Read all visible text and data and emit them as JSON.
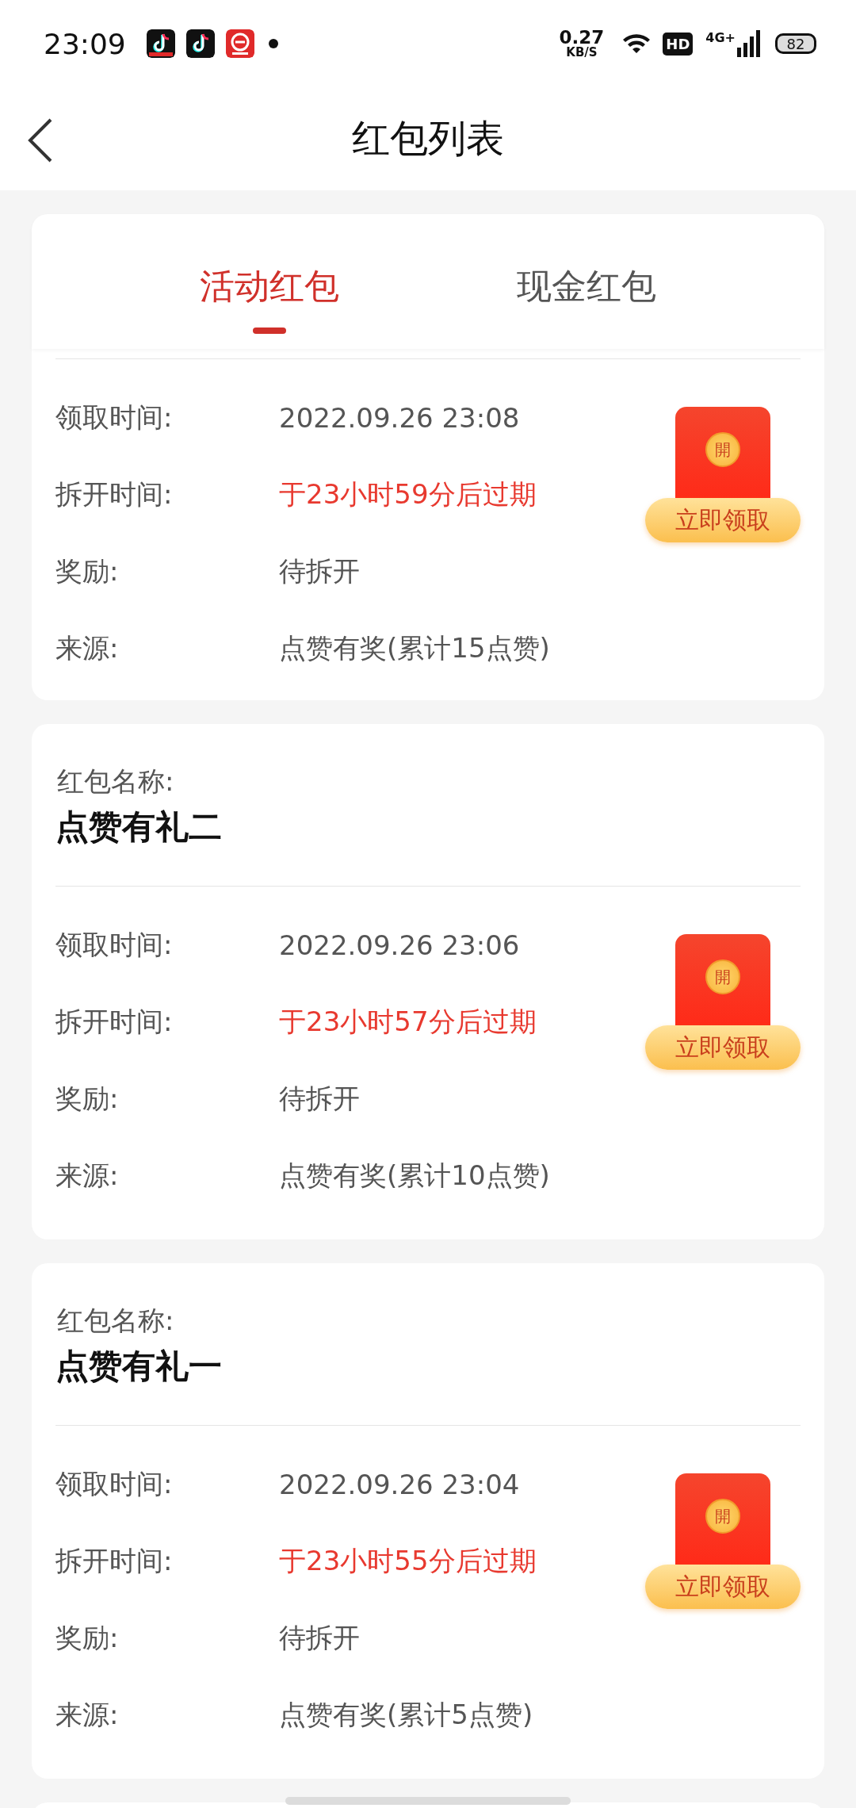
{
  "status_bar": {
    "time": "23:09",
    "speed": "0.27",
    "speed_unit": "KB/S",
    "hd": "HD",
    "network": "4G+",
    "battery": "82"
  },
  "header": {
    "title": "红包列表"
  },
  "tabs": [
    {
      "label": "活动红包",
      "selected": true
    },
    {
      "label": "现金红包",
      "selected": false
    }
  ],
  "cards": [
    {
      "fields": [
        {
          "label": "领取时间:",
          "value": "2022.09.26 23:08",
          "kind": "plain"
        },
        {
          "label": "拆开时间:",
          "value": "于23小时59分后过期",
          "kind": "expiry"
        },
        {
          "label": "奖励:",
          "value": "待拆开",
          "kind": "plain"
        },
        {
          "label": "来源:",
          "value": "点赞有奖(累计15点赞)",
          "kind": "plain"
        }
      ],
      "seal": "開",
      "button": "立即领取"
    },
    {
      "name_label": "红包名称:",
      "name": "点赞有礼二",
      "fields": [
        {
          "label": "领取时间:",
          "value": "2022.09.26 23:06",
          "kind": "plain"
        },
        {
          "label": "拆开时间:",
          "value": "于23小时57分后过期",
          "kind": "expiry"
        },
        {
          "label": "奖励:",
          "value": "待拆开",
          "kind": "plain"
        },
        {
          "label": "来源:",
          "value": "点赞有奖(累计10点赞)",
          "kind": "plain"
        }
      ],
      "seal": "開",
      "button": "立即领取"
    },
    {
      "name_label": "红包名称:",
      "name": "点赞有礼一",
      "fields": [
        {
          "label": "领取时间:",
          "value": "2022.09.26 23:04",
          "kind": "plain"
        },
        {
          "label": "拆开时间:",
          "value": "于23小时55分后过期",
          "kind": "expiry"
        },
        {
          "label": "奖励:",
          "value": "待拆开",
          "kind": "plain"
        },
        {
          "label": "来源:",
          "value": "点赞有奖(累计5点赞)",
          "kind": "plain"
        }
      ],
      "seal": "開",
      "button": "立即领取"
    }
  ]
}
